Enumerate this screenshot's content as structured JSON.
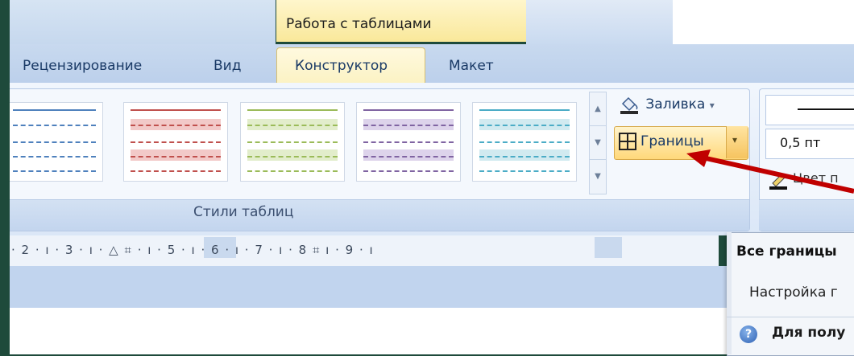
{
  "context_tab": {
    "title": "Работа с таблицами"
  },
  "tabs": [
    {
      "label": "Рецензирование"
    },
    {
      "label": "Вид"
    },
    {
      "label": "Конструктор",
      "active": true
    },
    {
      "label": "Макет"
    }
  ],
  "ribbon": {
    "styles_group_label": "Стили таблиц",
    "fill_label": "Заливка",
    "fill_dropdown": "▾",
    "borders_label": "Границы",
    "borders_dropdown": "▾",
    "line_weight": "0,5 пт",
    "pen_color_label": "Цвет п",
    "thumbnail_colors": [
      "#4f81bd",
      "#c0504d",
      "#9bbb59",
      "#8064a2",
      "#4bacc6"
    ],
    "scroll_up": "▲",
    "scroll_down": "▼",
    "scroll_more": "▼"
  },
  "ruler": {
    "text": "· 2 · ı · 3 · ı · △ ⌗ · ı · 5 · ı · 6 · ı · 7 · ı · 8 ⌗ ı · 9 · ı"
  },
  "dropdown_menu": {
    "all_borders": "Все границы",
    "setup": "Настройка г",
    "help": "Для полу",
    "help_icon": "?"
  },
  "colors": {
    "accent_active_tab": "#fbf2c2",
    "annotation_arrow": "#c00000",
    "desktop_bg": "#1e4a3b"
  }
}
